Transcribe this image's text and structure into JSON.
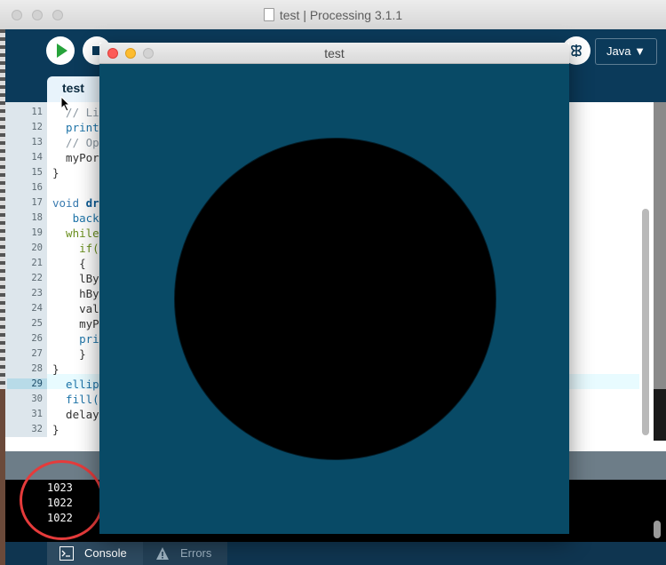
{
  "ide": {
    "window_title": "test | Processing 3.1.1",
    "mode": "Java ▼",
    "tab": "test",
    "line_numbers": [
      "11",
      "12",
      "13",
      "14",
      "15",
      "16",
      "17",
      "18",
      "19",
      "20",
      "21",
      "22",
      "23",
      "24",
      "25",
      "26",
      "27",
      "28",
      "29",
      "30",
      "31",
      "32"
    ],
    "code_lines": [
      {
        "seg": [
          {
            "t": "  // Li",
            "c": "#8a96a0"
          }
        ]
      },
      {
        "seg": [
          {
            "t": "  print",
            "c": "#1e74a8"
          }
        ]
      },
      {
        "seg": [
          {
            "t": "  // Op",
            "c": "#8a96a0"
          }
        ]
      },
      {
        "seg": [
          {
            "t": "  myPor",
            "c": "#333333"
          }
        ]
      },
      {
        "seg": [
          {
            "t": "}",
            "c": "#333333"
          }
        ]
      },
      {
        "seg": [
          {
            "t": "",
            "c": "#333333"
          }
        ]
      },
      {
        "seg": [
          {
            "t": "void ",
            "c": "#3a7bb0"
          },
          {
            "t": "dr",
            "c": "#0a5a94",
            "b": true
          }
        ]
      },
      {
        "seg": [
          {
            "t": "   back",
            "c": "#1e74a8"
          }
        ]
      },
      {
        "seg": [
          {
            "t": "  while",
            "c": "#6a8f1e"
          }
        ]
      },
      {
        "seg": [
          {
            "t": "    if(",
            "c": "#6a8f1e"
          }
        ]
      },
      {
        "seg": [
          {
            "t": "    {",
            "c": "#333333"
          }
        ]
      },
      {
        "seg": [
          {
            "t": "    lBy",
            "c": "#333333"
          }
        ]
      },
      {
        "seg": [
          {
            "t": "    hBy",
            "c": "#333333"
          }
        ]
      },
      {
        "seg": [
          {
            "t": "    val",
            "c": "#333333"
          }
        ]
      },
      {
        "seg": [
          {
            "t": "    myPo",
            "c": "#333333"
          }
        ]
      },
      {
        "seg": [
          {
            "t": "    pri",
            "c": "#1e74a8"
          }
        ]
      },
      {
        "seg": [
          {
            "t": "    }",
            "c": "#333333"
          }
        ]
      },
      {
        "seg": [
          {
            "t": "}",
            "c": "#333333"
          }
        ]
      },
      {
        "seg": [
          {
            "t": "  ellip",
            "c": "#1e74a8"
          }
        ]
      },
      {
        "seg": [
          {
            "t": "  fill(",
            "c": "#1e74a8"
          }
        ]
      },
      {
        "seg": [
          {
            "t": "  delay",
            "c": "#333333"
          }
        ]
      },
      {
        "seg": [
          {
            "t": "}",
            "c": "#333333"
          }
        ]
      }
    ],
    "console_lines": [
      "1023",
      "1022",
      "1022"
    ],
    "console_tab": "Console",
    "errors_tab": "Errors"
  },
  "sketch": {
    "window_title": "test",
    "background_color": "#084a66",
    "ellipse_color": "#000000"
  },
  "colors": {
    "toolbar": "#0b3a5a",
    "run_green": "#27a33b",
    "annotation_red": "#e53b3b"
  }
}
